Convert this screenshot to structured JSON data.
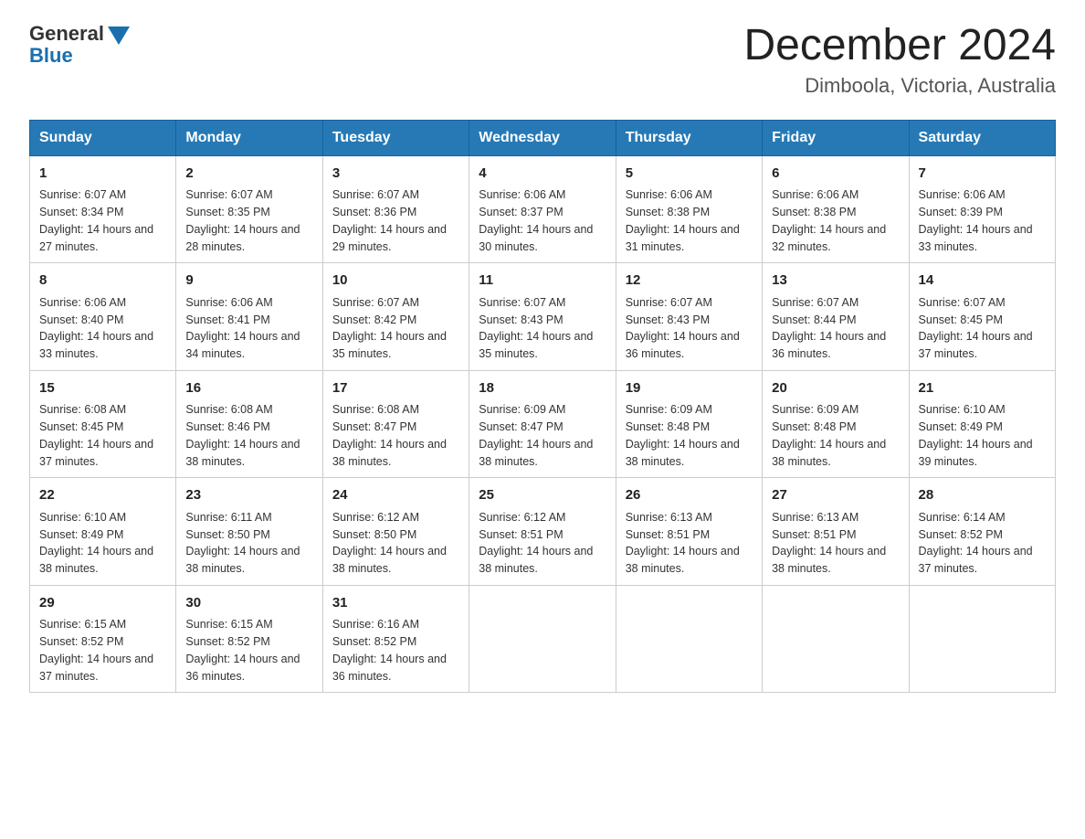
{
  "logo": {
    "general": "General",
    "blue": "Blue"
  },
  "header": {
    "month": "December 2024",
    "location": "Dimboola, Victoria, Australia"
  },
  "days_of_week": [
    "Sunday",
    "Monday",
    "Tuesday",
    "Wednesday",
    "Thursday",
    "Friday",
    "Saturday"
  ],
  "weeks": [
    [
      {
        "day": "1",
        "sunrise": "6:07 AM",
        "sunset": "8:34 PM",
        "daylight": "14 hours and 27 minutes."
      },
      {
        "day": "2",
        "sunrise": "6:07 AM",
        "sunset": "8:35 PM",
        "daylight": "14 hours and 28 minutes."
      },
      {
        "day": "3",
        "sunrise": "6:07 AM",
        "sunset": "8:36 PM",
        "daylight": "14 hours and 29 minutes."
      },
      {
        "day": "4",
        "sunrise": "6:06 AM",
        "sunset": "8:37 PM",
        "daylight": "14 hours and 30 minutes."
      },
      {
        "day": "5",
        "sunrise": "6:06 AM",
        "sunset": "8:38 PM",
        "daylight": "14 hours and 31 minutes."
      },
      {
        "day": "6",
        "sunrise": "6:06 AM",
        "sunset": "8:38 PM",
        "daylight": "14 hours and 32 minutes."
      },
      {
        "day": "7",
        "sunrise": "6:06 AM",
        "sunset": "8:39 PM",
        "daylight": "14 hours and 33 minutes."
      }
    ],
    [
      {
        "day": "8",
        "sunrise": "6:06 AM",
        "sunset": "8:40 PM",
        "daylight": "14 hours and 33 minutes."
      },
      {
        "day": "9",
        "sunrise": "6:06 AM",
        "sunset": "8:41 PM",
        "daylight": "14 hours and 34 minutes."
      },
      {
        "day": "10",
        "sunrise": "6:07 AM",
        "sunset": "8:42 PM",
        "daylight": "14 hours and 35 minutes."
      },
      {
        "day": "11",
        "sunrise": "6:07 AM",
        "sunset": "8:43 PM",
        "daylight": "14 hours and 35 minutes."
      },
      {
        "day": "12",
        "sunrise": "6:07 AM",
        "sunset": "8:43 PM",
        "daylight": "14 hours and 36 minutes."
      },
      {
        "day": "13",
        "sunrise": "6:07 AM",
        "sunset": "8:44 PM",
        "daylight": "14 hours and 36 minutes."
      },
      {
        "day": "14",
        "sunrise": "6:07 AM",
        "sunset": "8:45 PM",
        "daylight": "14 hours and 37 minutes."
      }
    ],
    [
      {
        "day": "15",
        "sunrise": "6:08 AM",
        "sunset": "8:45 PM",
        "daylight": "14 hours and 37 minutes."
      },
      {
        "day": "16",
        "sunrise": "6:08 AM",
        "sunset": "8:46 PM",
        "daylight": "14 hours and 38 minutes."
      },
      {
        "day": "17",
        "sunrise": "6:08 AM",
        "sunset": "8:47 PM",
        "daylight": "14 hours and 38 minutes."
      },
      {
        "day": "18",
        "sunrise": "6:09 AM",
        "sunset": "8:47 PM",
        "daylight": "14 hours and 38 minutes."
      },
      {
        "day": "19",
        "sunrise": "6:09 AM",
        "sunset": "8:48 PM",
        "daylight": "14 hours and 38 minutes."
      },
      {
        "day": "20",
        "sunrise": "6:09 AM",
        "sunset": "8:48 PM",
        "daylight": "14 hours and 38 minutes."
      },
      {
        "day": "21",
        "sunrise": "6:10 AM",
        "sunset": "8:49 PM",
        "daylight": "14 hours and 39 minutes."
      }
    ],
    [
      {
        "day": "22",
        "sunrise": "6:10 AM",
        "sunset": "8:49 PM",
        "daylight": "14 hours and 38 minutes."
      },
      {
        "day": "23",
        "sunrise": "6:11 AM",
        "sunset": "8:50 PM",
        "daylight": "14 hours and 38 minutes."
      },
      {
        "day": "24",
        "sunrise": "6:12 AM",
        "sunset": "8:50 PM",
        "daylight": "14 hours and 38 minutes."
      },
      {
        "day": "25",
        "sunrise": "6:12 AM",
        "sunset": "8:51 PM",
        "daylight": "14 hours and 38 minutes."
      },
      {
        "day": "26",
        "sunrise": "6:13 AM",
        "sunset": "8:51 PM",
        "daylight": "14 hours and 38 minutes."
      },
      {
        "day": "27",
        "sunrise": "6:13 AM",
        "sunset": "8:51 PM",
        "daylight": "14 hours and 38 minutes."
      },
      {
        "day": "28",
        "sunrise": "6:14 AM",
        "sunset": "8:52 PM",
        "daylight": "14 hours and 37 minutes."
      }
    ],
    [
      {
        "day": "29",
        "sunrise": "6:15 AM",
        "sunset": "8:52 PM",
        "daylight": "14 hours and 37 minutes."
      },
      {
        "day": "30",
        "sunrise": "6:15 AM",
        "sunset": "8:52 PM",
        "daylight": "14 hours and 36 minutes."
      },
      {
        "day": "31",
        "sunrise": "6:16 AM",
        "sunset": "8:52 PM",
        "daylight": "14 hours and 36 minutes."
      },
      null,
      null,
      null,
      null
    ]
  ]
}
